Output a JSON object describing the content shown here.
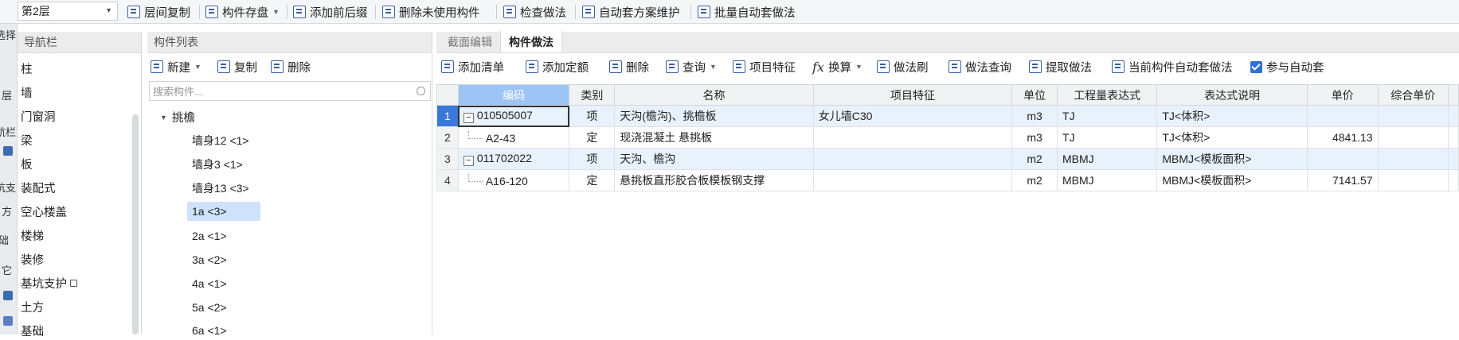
{
  "topbar": {
    "floor": "第2层",
    "buttons": [
      {
        "label": "层间复制",
        "icon": "copy-floor-icon"
      },
      {
        "label": "构件存盘",
        "icon": "save-component-icon",
        "dropdown": true
      },
      {
        "label": "添加前后缀",
        "icon": "add-prefix-icon"
      },
      {
        "label": "删除未使用构件",
        "icon": "delete-unused-icon"
      },
      {
        "label": "检查做法",
        "icon": "check-method-icon"
      },
      {
        "label": "自动套方案维护",
        "icon": "auto-scheme-icon"
      },
      {
        "label": "批量自动套做法",
        "icon": "batch-auto-icon"
      }
    ]
  },
  "leftstrip": {
    "labels": [
      "选择",
      "层",
      "航栏",
      "抗支",
      "方",
      "础",
      "它"
    ]
  },
  "nav": {
    "title": "导航栏",
    "items": [
      "柱",
      "墙",
      "门窗洞",
      "梁",
      "板",
      "装配式",
      "空心楼盖",
      "楼梯",
      "装修",
      "基坑支护",
      "土方",
      "基础"
    ]
  },
  "components": {
    "title": "构件列表",
    "toolbar": {
      "new": "新建",
      "copy": "复制",
      "delete": "删除"
    },
    "search_placeholder": "搜索构件...",
    "group": "挑檐",
    "items": [
      "墙身12 <1>",
      "墙身3 <1>",
      "墙身13 <3>",
      "1a <3>",
      "2a <1>",
      "3a <2>",
      "4a <1>",
      "5a <2>",
      "6a <1>"
    ],
    "selected_index": 3
  },
  "main": {
    "tabs": [
      "截面编辑",
      "构件做法"
    ],
    "active_tab": 1,
    "toolbar": [
      {
        "label": "添加清单",
        "icon": "add-list-icon"
      },
      {
        "label": "添加定额",
        "icon": "add-quota-icon"
      },
      {
        "label": "删除",
        "icon": "delete-icon"
      },
      {
        "label": "查询",
        "icon": "query-icon",
        "dropdown": true
      },
      {
        "label": "项目特征",
        "icon": "feature-icon"
      },
      {
        "label": "换算",
        "icon": "formula-icon",
        "dropdown": true
      },
      {
        "label": "做法刷",
        "icon": "method-brush-icon"
      },
      {
        "label": "做法查询",
        "icon": "method-query-icon"
      },
      {
        "label": "提取做法",
        "icon": "extract-method-icon"
      },
      {
        "label": "当前构件自动套做法",
        "icon": "auto-apply-icon"
      }
    ],
    "auto_apply_label": "参与自动套",
    "auto_apply_checked": true,
    "columns": [
      "编码",
      "类别",
      "名称",
      "项目特征",
      "单位",
      "工程量表达式",
      "表达式说明",
      "单价",
      "综合单价"
    ],
    "rows": [
      {
        "no": "1",
        "code": "010505007",
        "type": "项",
        "name": "天沟(檐沟)、挑檐板",
        "feature": "女儿墙C30",
        "unit": "m3",
        "expr": "TJ",
        "expr_desc": "TJ<体积>",
        "price": "",
        "total_price": "",
        "expand": "−"
      },
      {
        "no": "2",
        "code": "A2-43",
        "type": "定",
        "name": "现浇混凝土 悬挑板",
        "feature": "",
        "unit": "m3",
        "expr": "TJ",
        "expr_desc": "TJ<体积>",
        "price": "4841.13",
        "total_price": ""
      },
      {
        "no": "3",
        "code": "011702022",
        "type": "项",
        "name": "天沟、檐沟",
        "feature": "",
        "unit": "m2",
        "expr": "MBMJ",
        "expr_desc": "MBMJ<模板面积>",
        "price": "",
        "total_price": "",
        "expand": "−"
      },
      {
        "no": "4",
        "code": "A16-120",
        "type": "定",
        "name": "悬挑板直形胶合板模板钢支撑",
        "feature": "",
        "unit": "m2",
        "expr": "MBMJ",
        "expr_desc": "MBMJ<模板面积>",
        "price": "7141.57",
        "total_price": ""
      }
    ]
  },
  "colors": {
    "accent": "#3a78d8",
    "selection": "#cfe2fb",
    "row_alt": "#e8f2fd",
    "header_hl": "#9cc4f5"
  }
}
